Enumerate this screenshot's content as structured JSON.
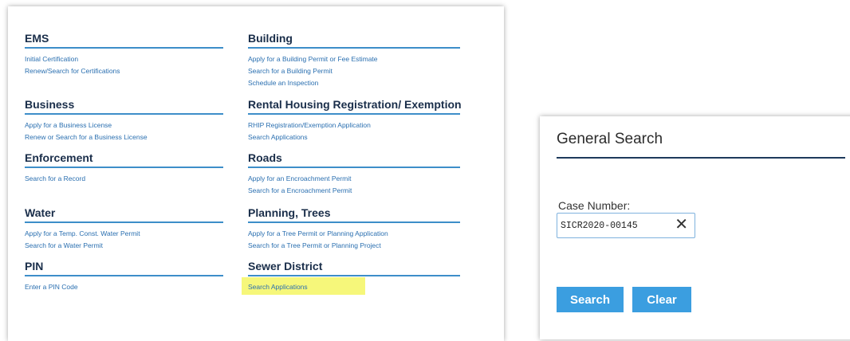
{
  "services": {
    "ems": {
      "title": "EMS",
      "links": [
        "Initial Certification",
        "Renew/Search for Certifications"
      ]
    },
    "business": {
      "title": "Business",
      "links": [
        "Apply for a Business License",
        "Renew or Search for a Business License"
      ]
    },
    "enforcement": {
      "title": "Enforcement",
      "links": [
        "Search for a Record"
      ]
    },
    "water": {
      "title": "Water",
      "links": [
        "Apply for a Temp. Const. Water Permit",
        "Search for a Water Permit"
      ]
    },
    "pin": {
      "title": "PIN",
      "links": [
        "Enter a PIN Code"
      ]
    },
    "building": {
      "title": "Building",
      "links": [
        "Apply for a Building Permit or Fee Estimate",
        "Search for a Building Permit",
        "Schedule an Inspection"
      ]
    },
    "rental": {
      "title": "Rental Housing Registration/ Exemption",
      "links": [
        "RHIP Registration/Exemption Application",
        "Search Applications"
      ]
    },
    "roads": {
      "title": "Roads",
      "links": [
        "Apply for an Encroachment Permit",
        "Search for a Encroachment Permit"
      ]
    },
    "planning": {
      "title": "Planning, Trees",
      "links": [
        "Apply for a Tree Permit or Planning Application",
        "Search for a Tree Permit or Planning Project"
      ]
    },
    "sewer": {
      "title": "Sewer District",
      "links": [
        "Search Applications"
      ]
    }
  },
  "general_search": {
    "title": "General Search",
    "case_label": "Case Number:",
    "case_value": "SICR2020-00145",
    "clear_glyph": "✕",
    "search_button": "Search",
    "clear_button": "Clear"
  },
  "colors": {
    "heading": "#1a2e4a",
    "link": "#2a6fb0",
    "underline": "#3d8ec9",
    "highlight": "#f6f77a",
    "button": "#3b9ee0"
  }
}
